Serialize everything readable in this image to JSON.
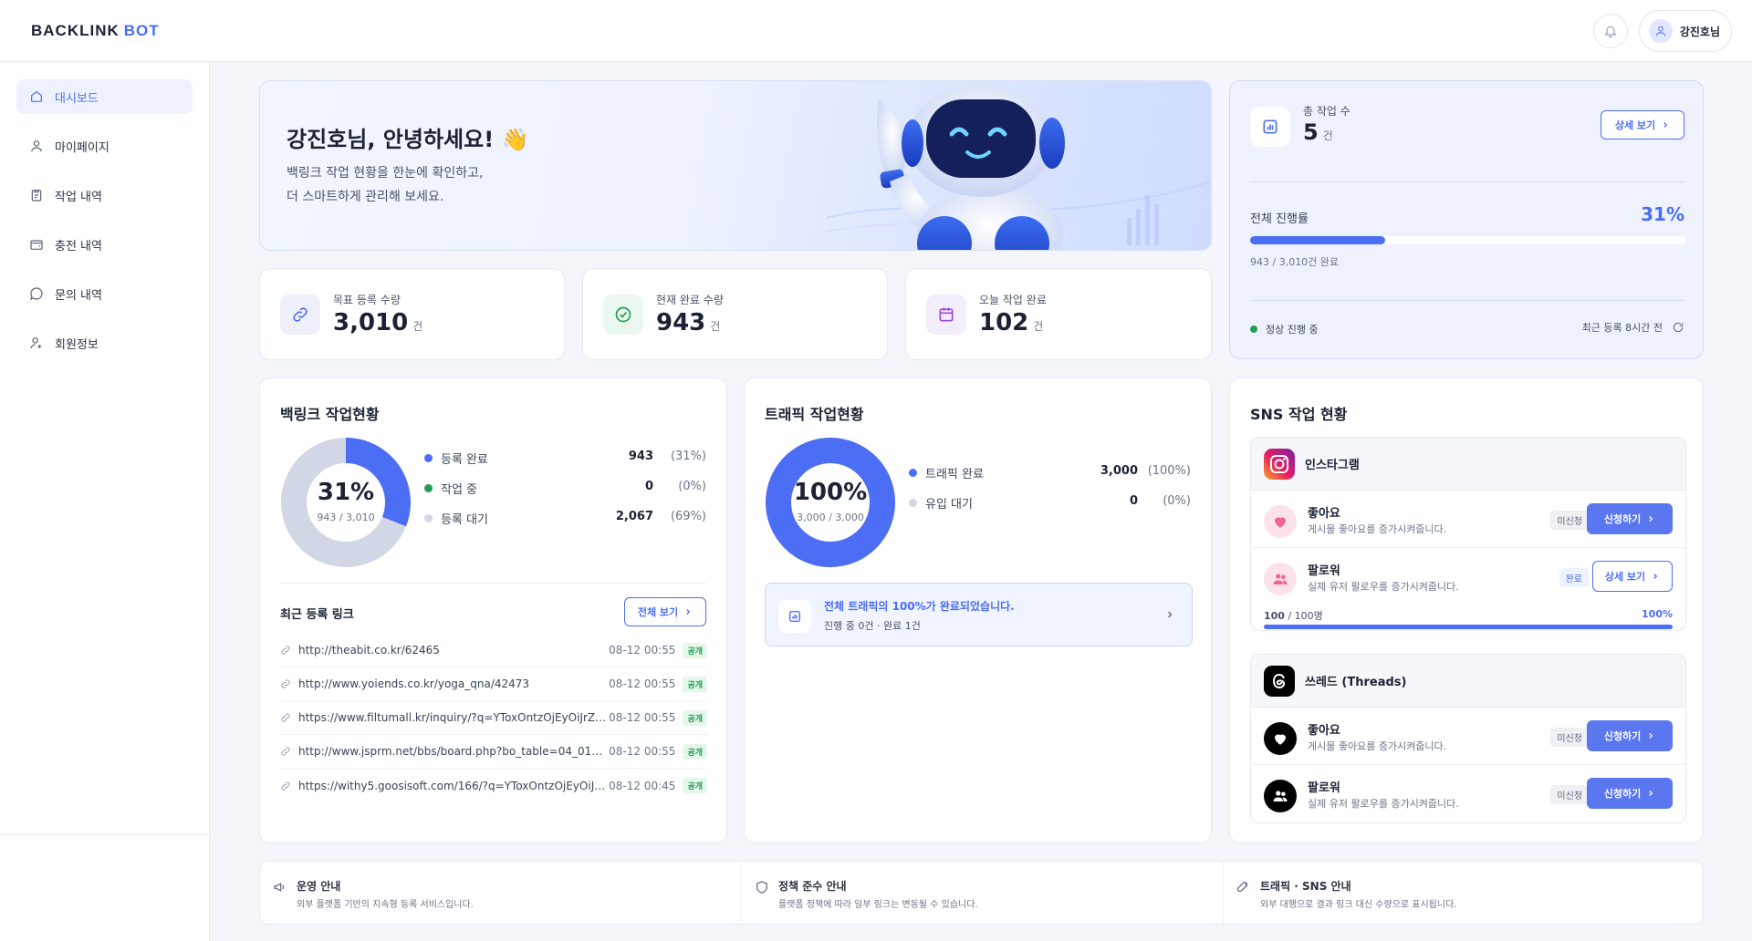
{
  "brand": {
    "name": "BACKLINK",
    "suffix": "BOT",
    "accent": "#4c6ef5"
  },
  "user": {
    "name": "강진호님"
  },
  "sidebar": {
    "items": [
      {
        "label": "대시보드",
        "icon": "home-icon",
        "active": true
      },
      {
        "label": "마이페이지",
        "icon": "user-icon"
      },
      {
        "label": "작업 내역",
        "icon": "clipboard-icon"
      },
      {
        "label": "충전 내역",
        "icon": "wallet-icon"
      },
      {
        "label": "문의 내역",
        "icon": "chat-icon"
      },
      {
        "label": "회원정보",
        "icon": "user-settings-icon"
      }
    ]
  },
  "hero": {
    "title": "강진호님, 안녕하세요! 👋",
    "line1": "백링크 작업 현황을 한눈에 확인하고,",
    "line2": "더 스마트하게 관리해 보세요."
  },
  "stats": [
    {
      "label": "목표 등록 수량",
      "value": "3,010",
      "unit": "건",
      "icon": "link-icon"
    },
    {
      "label": "현재 완료 수량",
      "value": "943",
      "unit": "건",
      "icon": "check-circle-icon"
    },
    {
      "label": "오늘 작업 완료",
      "value": "102",
      "unit": "건",
      "icon": "calendar-icon"
    }
  ],
  "summary": {
    "total_label": "총 작업 수",
    "total_value": "5",
    "total_unit": "건",
    "detail_btn": "상세 보기",
    "progress_label": "전체 진행률",
    "progress_pct": "31%",
    "progress_value": 0.31,
    "progress_sub": "943 / 3,010건 완료",
    "status": "정상 진행 중",
    "status_color": "#1f9d55",
    "last_update": "최근 등록 8시간 전"
  },
  "backlink": {
    "title": "백링크 작업현황",
    "center_pct": "31%",
    "center_sub": "943 / 3,010",
    "legend": [
      {
        "label": "등록 완료",
        "value": "943",
        "pct": "(31%)",
        "color": "#4c6ef5"
      },
      {
        "label": "작업 중",
        "value": "0",
        "pct": "(0%)",
        "color": "#1f9d55"
      },
      {
        "label": "등록 대기",
        "value": "2,067",
        "pct": "(69%)",
        "color": "#d2d7e5"
      }
    ],
    "donut_fraction": 0.31,
    "recent_title": "최근 등록 링크",
    "view_all": "전체 보기",
    "links": [
      {
        "url": "http://theabit.co.kr/62465",
        "date": "08-12 00:55",
        "tag": "공개"
      },
      {
        "url": "http://www.yoiends.co.kr/yoga_qna/42473",
        "date": "08-12 00:55",
        "tag": "공개"
      },
      {
        "url": "https://www.filtumall.kr/inquiry/?q=YToxOntzOjEyOiJrZXl3b...",
        "date": "08-12 00:55",
        "tag": "공개"
      },
      {
        "url": "http://www.jsprm.net/bbs/board.php?bo_table=04_01&wr_i...",
        "date": "08-12 00:55",
        "tag": "공개"
      },
      {
        "url": "https://withy5.goosisoft.com/166/?q=YToxOntzOjEyOiJrZXl...",
        "date": "08-12 00:45",
        "tag": "공개"
      }
    ]
  },
  "traffic": {
    "title": "트래픽 작업현황",
    "center_pct": "100%",
    "center_sub": "3,000 / 3,000",
    "donut_fraction": 1.0,
    "legend": [
      {
        "label": "트래픽 완료",
        "value": "3,000",
        "pct": "(100%)",
        "color": "#4c6ef5"
      },
      {
        "label": "유입 대기",
        "value": "0",
        "pct": "(0%)",
        "color": "#d2d7e5"
      }
    ],
    "notice_title": "전체 트래픽의 100%가 완료되었습니다.",
    "notice_sub": "진행 중 0건 · 완료 1건"
  },
  "sns": {
    "title": "SNS 작업 현황",
    "instagram": {
      "name": "인스타그램",
      "rows": [
        {
          "title": "좋아요",
          "desc": "게시물 좋아요를 증가시켜줍니다.",
          "badge": "미신청",
          "btn": "신청하기",
          "icon": "heart-icon"
        },
        {
          "title": "팔로워",
          "desc": "실제 유저 팔로우를 증가시켜줍니다.",
          "badge": "완료",
          "btn": "상세 보기",
          "icon": "users-icon"
        }
      ],
      "progress_text": "100",
      "progress_total": " / 100명",
      "progress_pct": "100%",
      "progress_value": 1.0
    },
    "threads": {
      "name": "쓰레드 (Threads)",
      "rows": [
        {
          "title": "좋아요",
          "desc": "게시물 좋아요를 증가시켜줍니다.",
          "badge": "미신청",
          "btn": "신청하기",
          "icon": "heart-icon"
        },
        {
          "title": "팔로워",
          "desc": "실제 유저 팔로우를 증가시켜줍니다.",
          "badge": "미신청",
          "btn": "신청하기",
          "icon": "users-icon"
        }
      ]
    }
  },
  "footer": [
    {
      "title": "운영 안내",
      "desc": "외부 플랫폼 기반의 지속형 등록 서비스입니다.",
      "icon": "megaphone-icon"
    },
    {
      "title": "정책 준수 안내",
      "desc": "플랫폼 정책에 따라 일부 링크는 변동될 수 있습니다.",
      "icon": "shield-icon"
    },
    {
      "title": "트래픽 · SNS 안내",
      "desc": "외부 대행으로 결과 링크 대신 수량으로 표시됩니다.",
      "icon": "rocket-icon"
    }
  ]
}
